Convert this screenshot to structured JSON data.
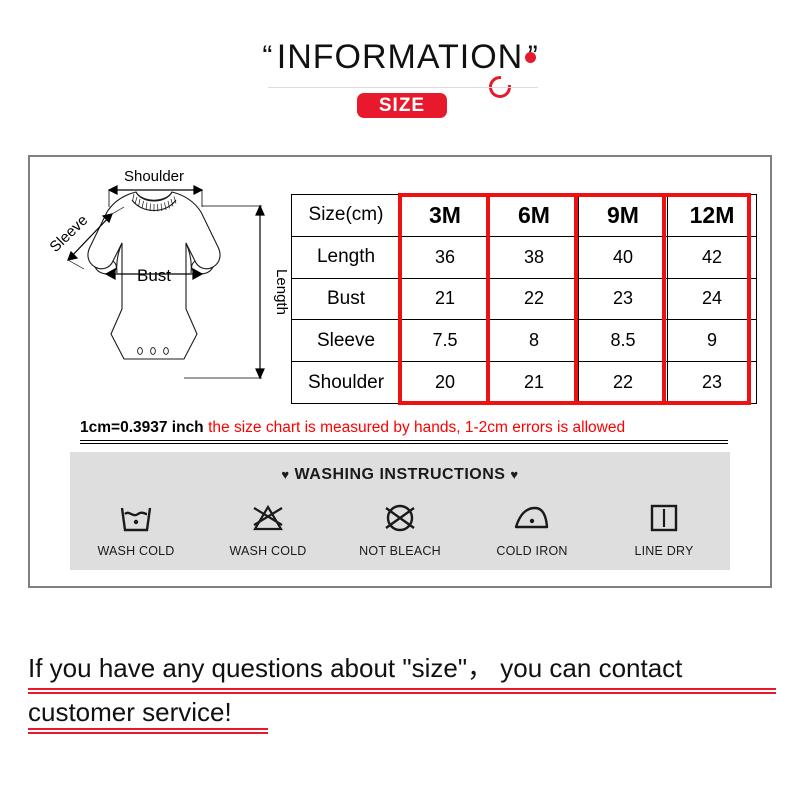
{
  "header": {
    "open_quote": "“",
    "title": "INFORMATION",
    "close_quote": "”",
    "badge_label": "SIZE",
    "accent_color": "#e8192c"
  },
  "diagram": {
    "label_shoulder": "Shoulder",
    "label_sleeve": "Sleeve",
    "label_bust": "Bust",
    "label_length": "Length",
    "alt": "baby bodysuit romper line drawing with measurement arrows"
  },
  "size_table": {
    "corner_header": "Size(cm)",
    "columns": [
      "3M",
      "6M",
      "9M",
      "12M"
    ],
    "rows": [
      {
        "label": "Length",
        "values": [
          "36",
          "38",
          "40",
          "42"
        ]
      },
      {
        "label": "Bust",
        "values": [
          "21",
          "22",
          "23",
          "24"
        ]
      },
      {
        "label": "Sleeve",
        "values": [
          "7.5",
          "8",
          "8.5",
          "9"
        ]
      },
      {
        "label": "Shoulder",
        "values": [
          "20",
          "21",
          "22",
          "23"
        ]
      }
    ],
    "highlight_color": "#ee1111"
  },
  "note": {
    "conversion": "1cm=0.3937 inch",
    "disclaimer": "the size chart is measured by hands, 1-2cm errors is allowed",
    "disclaimer_color": "#fe0000"
  },
  "washing": {
    "heart_left": "♥",
    "title": "WASHING INSTRUCTIONS",
    "heart_right": "♥",
    "items": [
      {
        "icon": "wash-tub-one-dot-icon",
        "label": "WASH COLD"
      },
      {
        "icon": "no-bleach-triangle-icon",
        "label": "WASH COLD"
      },
      {
        "icon": "no-dryclean-circle-icon",
        "label": "NOT BLEACH"
      },
      {
        "icon": "iron-one-dot-icon",
        "label": "COLD IRON"
      },
      {
        "icon": "line-dry-square-icon",
        "label": "LINE DRY"
      }
    ],
    "panel_color": "#dedede"
  },
  "footer": {
    "line1": "If you have any questions about \"size\"， you can contact",
    "line2": "customer service!",
    "underline_color": "#e8192c"
  }
}
